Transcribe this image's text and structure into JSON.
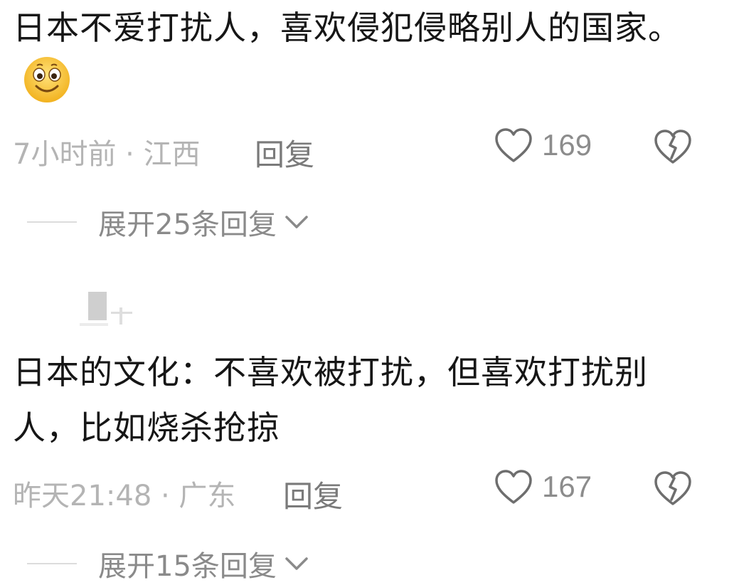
{
  "comments": [
    {
      "text": "日本不爱打扰人，喜欢侵犯侵略别人的国家。",
      "emoji": "smiley-emoji",
      "time_location": "7小时前 · 江西",
      "reply_label": "回复",
      "likes": "169",
      "expand_label": "展开25条回复"
    },
    {
      "text": "日本的文化：不喜欢被打扰，但喜欢打扰别人，比如烧杀抢掠",
      "time_location": "昨天21:48 · 广东",
      "reply_label": "回复",
      "likes": "167",
      "expand_label": "展开15条回复"
    }
  ],
  "icons": {
    "like": "heart-icon",
    "dislike": "broken-heart-icon",
    "expand": "chevron-down-icon"
  },
  "colors": {
    "text": "#161616",
    "meta": "#b4b4b4",
    "action": "#7a7a7a",
    "icon": "#6e6e6e",
    "emoji_face": "#f7c33c"
  }
}
